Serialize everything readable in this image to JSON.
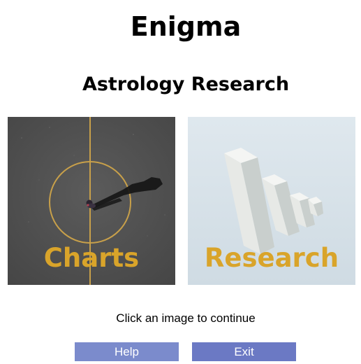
{
  "app": {
    "title": "Enigma",
    "subtitle": "Astrology Research"
  },
  "tiles": [
    {
      "label": "Charts",
      "image": "aerial photo of a person standing in a painted circle on asphalt"
    },
    {
      "label": "Research",
      "image": "3d white bar chart with descending columns"
    }
  ],
  "prompt": "Click an image to continue",
  "buttons": {
    "help": "Help",
    "exit": "Exit"
  },
  "colors": {
    "label_gold": "#d9a42a",
    "help_button": "#7b8bcc",
    "exit_button": "#6b79c4"
  }
}
